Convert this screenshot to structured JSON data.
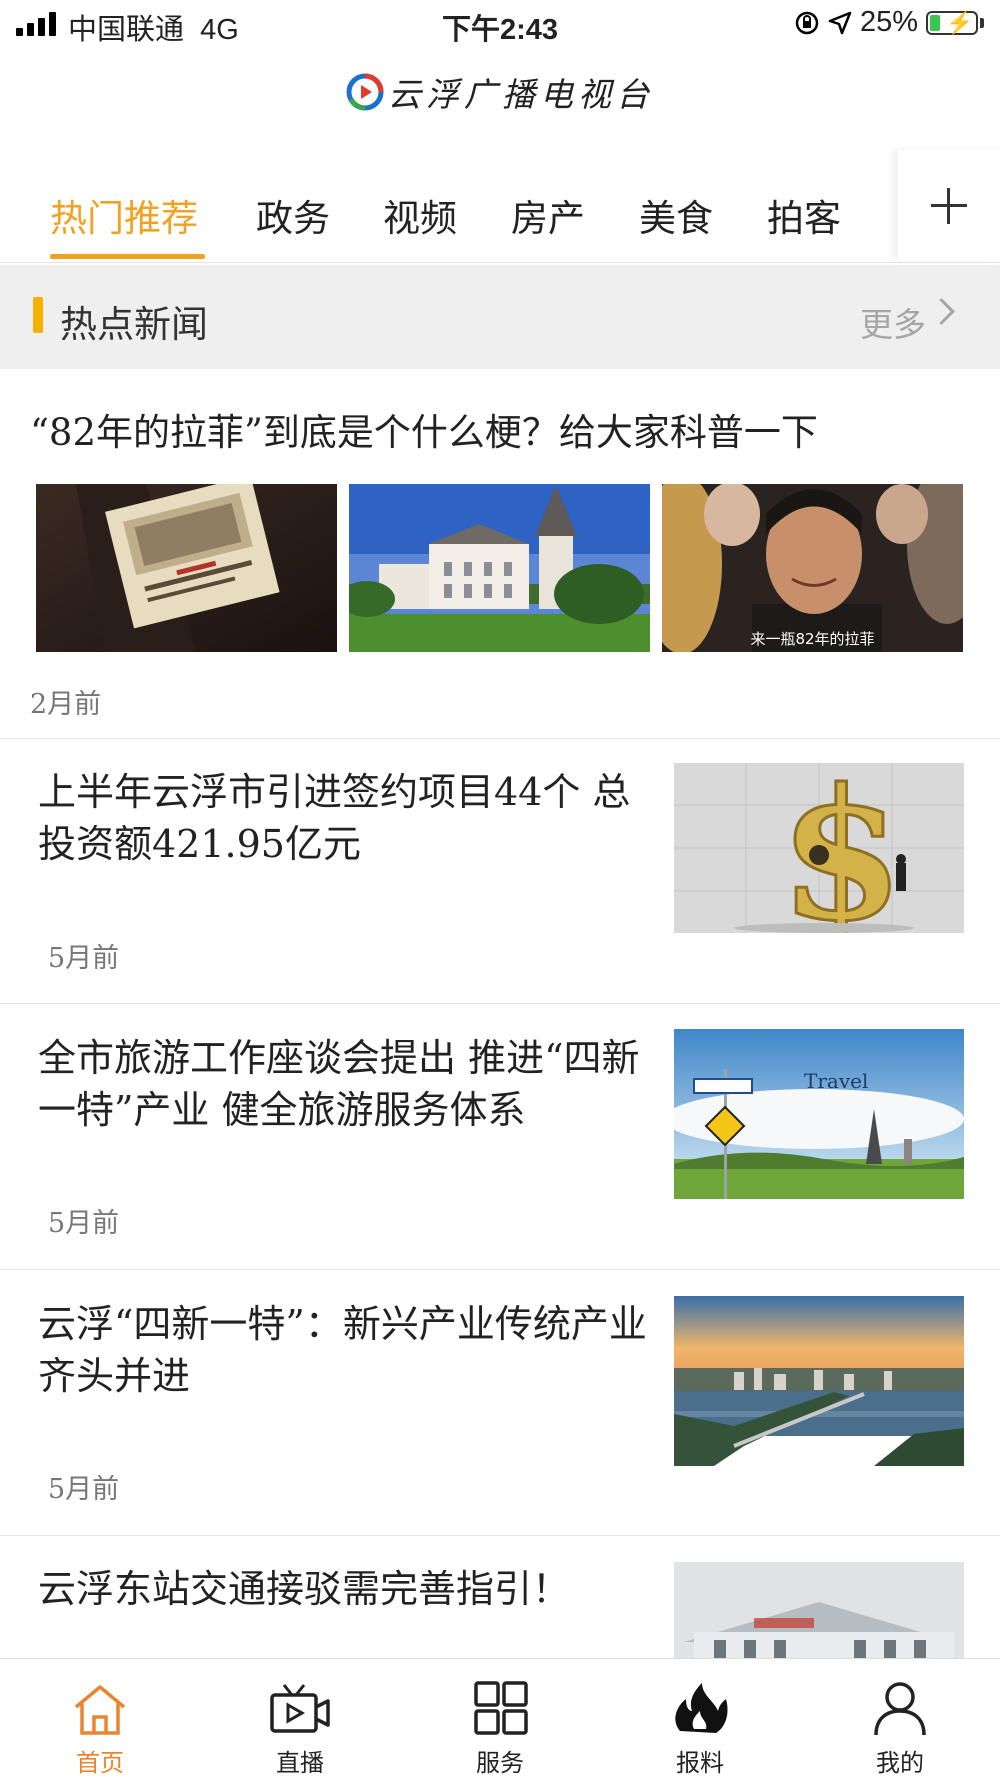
{
  "status_bar": {
    "carrier": "中国联通",
    "network": "4G",
    "time": "下午2:43",
    "battery": "25%"
  },
  "header": {
    "title": "云浮广播电视台"
  },
  "tabs": [
    {
      "label": "热门推荐",
      "active": true
    },
    {
      "label": "政务"
    },
    {
      "label": "视频"
    },
    {
      "label": "房产"
    },
    {
      "label": "美食"
    },
    {
      "label": "拍客"
    }
  ],
  "section": {
    "title": "热点新闻",
    "more": "更多"
  },
  "featured": {
    "title": "“82年的拉菲”到底是个什么梗？给大家科普一下",
    "time": "2月前",
    "caption": "来一瓶82年的拉菲"
  },
  "news": [
    {
      "title": "上半年云浮市引进签约项目44个 总投资额421.95亿元",
      "time": "5月前"
    },
    {
      "title": "全市旅游工作座谈会提出 推进“四新一特”产业 健全旅游服务体系",
      "time": "5月前",
      "image_text": "Travel"
    },
    {
      "title": "云浮“四新一特”：新兴产业传统产业齐头并进",
      "time": "5月前"
    },
    {
      "title": "云浮东站交通接驳需完善指引！"
    }
  ],
  "bottom_nav": [
    {
      "label": "首页",
      "icon": "home-icon",
      "active": true
    },
    {
      "label": "直播",
      "icon": "tv-icon"
    },
    {
      "label": "服务",
      "icon": "grid-icon"
    },
    {
      "label": "报料",
      "icon": "flame-icon"
    },
    {
      "label": "我的",
      "icon": "user-icon"
    }
  ],
  "colors": {
    "accent": "#f1a222",
    "nav_active": "#e8852e",
    "section_bg": "#efefef"
  }
}
